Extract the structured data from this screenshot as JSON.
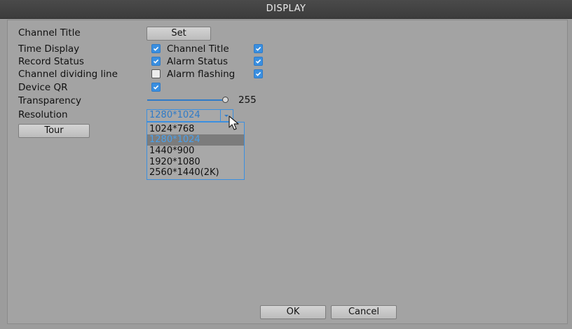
{
  "window": {
    "title": "DISPLAY"
  },
  "rows": {
    "channel_title": {
      "label": "Channel Title",
      "button": "Set"
    },
    "time_display": {
      "label": "Time Display",
      "checked": true,
      "right_label": "Channel Title",
      "right_checked": true
    },
    "record_status": {
      "label": "Record Status",
      "checked": true,
      "right_label": "Alarm Status",
      "right_checked": true
    },
    "dividing_line": {
      "label": "Channel dividing line",
      "checked": false,
      "right_label": "Alarm flashing",
      "right_checked": true
    },
    "device_qr": {
      "label": "Device QR",
      "checked": true
    },
    "transparency": {
      "label": "Transparency",
      "value": "255"
    },
    "resolution": {
      "label": "Resolution",
      "selected": "1280*1024",
      "options": [
        "1024*768",
        "1280*1024",
        "1440*900",
        "1920*1080",
        "2560*1440(2K)"
      ]
    }
  },
  "buttons": {
    "tour": "Tour",
    "ok": "OK",
    "cancel": "Cancel"
  },
  "colors": {
    "accent": "#3a8fe0",
    "titlebar": "#404040",
    "background": "#a3a3a3"
  },
  "icons": {
    "cursor": "arrow-cursor-icon",
    "dropdown": "chevron-down-icon",
    "check": "check-icon"
  }
}
